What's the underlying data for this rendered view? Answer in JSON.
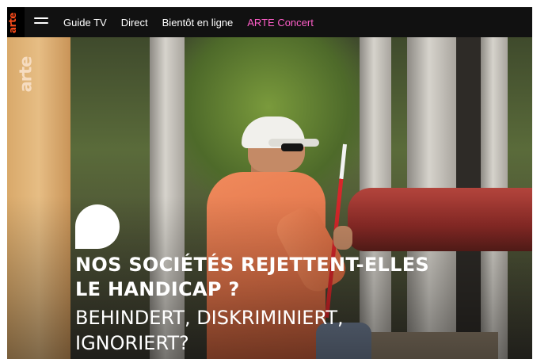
{
  "header": {
    "logo": "arte",
    "menu_icon": "hamburger-menu-icon",
    "nav": [
      {
        "label": "Guide TV"
      },
      {
        "label": "Direct"
      },
      {
        "label": "Bientôt en ligne"
      },
      {
        "label": "ARTE Concert",
        "color": "#ff5ec9"
      }
    ]
  },
  "hero": {
    "side_logo": "arte",
    "icon": "speech-bubble-icon",
    "title_fr_line1": "NOS SOCIÉTÉS REJETTENT-ELLES",
    "title_fr_line2": "LE HANDICAP ?",
    "title_de_line1": "BEHINDERT, DISKRIMINIERT,",
    "title_de_line2": "IGNORIERT?"
  },
  "colors": {
    "brand": "#fa4b1a",
    "accent": "#ff5ec9",
    "topbar": "#111111"
  }
}
